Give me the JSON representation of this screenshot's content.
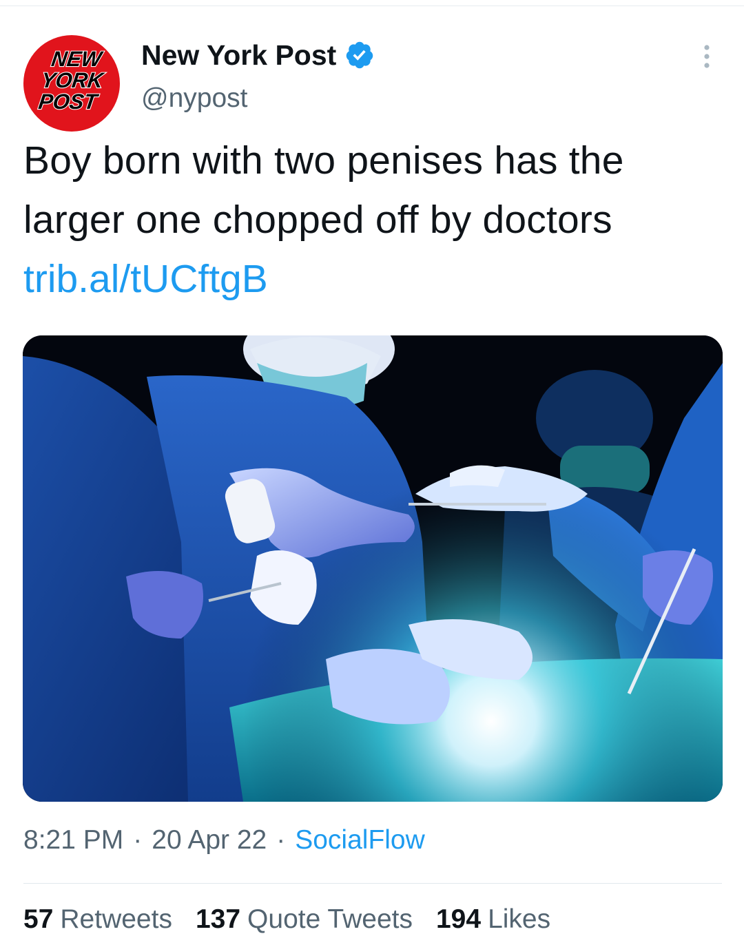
{
  "author": {
    "display_name": "New York Post",
    "handle": "@nypost",
    "verified": true,
    "avatar_logo_lines": [
      "NEW",
      "YORK",
      "POST"
    ],
    "avatar_color": "#e1141c"
  },
  "tweet": {
    "text": "Boy born with two penises has the larger one chopped off by doctors",
    "link": "trib.al/tUCftgB"
  },
  "media": {
    "description_icon": "surgery-photo"
  },
  "meta": {
    "time": "8:21 PM",
    "separator": "·",
    "date": "20 Apr 22",
    "source": "SocialFlow"
  },
  "stats": {
    "retweets_count": "57",
    "retweets_label": "Retweets",
    "quotes_count": "137",
    "quotes_label": "Quote Tweets",
    "likes_count": "194",
    "likes_label": "Likes"
  },
  "colors": {
    "link": "#1d9bf0",
    "secondary_text": "#536471",
    "primary_text": "#0f1419"
  }
}
